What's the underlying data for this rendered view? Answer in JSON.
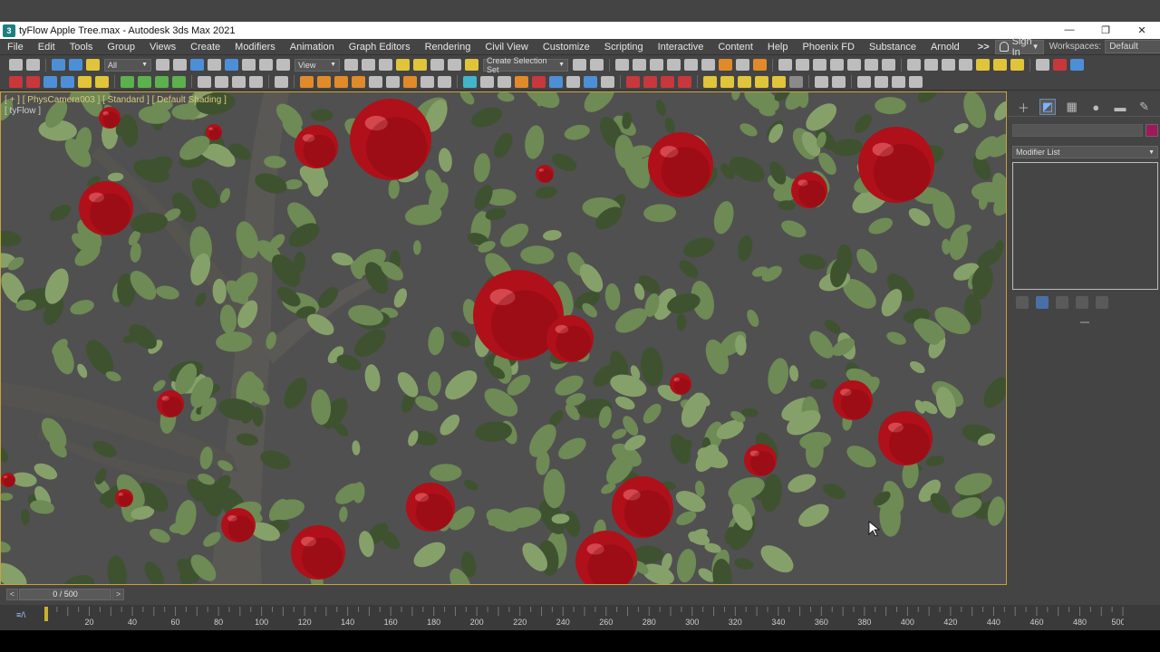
{
  "window": {
    "title": "tyFlow Apple Tree.max - Autodesk 3ds Max 2021",
    "app_icon_letter": "3",
    "minimize_glyph": "—",
    "restore_glyph": "❐",
    "close_glyph": "✕"
  },
  "menubar": {
    "items": [
      "File",
      "Edit",
      "Tools",
      "Group",
      "Views",
      "Create",
      "Modifiers",
      "Animation",
      "Graph Editors",
      "Rendering",
      "Civil View",
      "Customize",
      "Scripting",
      "Interactive",
      "Content",
      "Help",
      "Phoenix FD",
      "Substance",
      "Arnold"
    ],
    "more": ">>",
    "sign_in": "Sign In",
    "workspaces_label": "Workspaces:",
    "workspace_value": "Default"
  },
  "toolbar": {
    "selection_filter": "All",
    "reference_coord": "View",
    "named_selection": "Create Selection Set"
  },
  "viewport": {
    "label": "[ + ] [ PhysCamera003 ] [ Standard ] [ Default Shading ]",
    "sublabel": "[ tyFlow ]",
    "colors": {
      "leaf": "#6e8a55",
      "leaf_dark": "#3e5230",
      "apple": "#b0101a",
      "trunk": "#5a5854",
      "background": "#505050"
    }
  },
  "command_panel": {
    "tabs": [
      "create-tab",
      "modify-tab",
      "hierarchy-tab",
      "motion-tab",
      "display-tab",
      "utilities-tab"
    ],
    "modifier_list": "Modifier List",
    "object_color": "#a0185a"
  },
  "timeslider": {
    "position": "0 / 500",
    "prev": "<",
    "next": ">"
  },
  "trackbar": {
    "icon_text": "≡/\\",
    "ticks": [
      20,
      40,
      60,
      80,
      100,
      120,
      140,
      160,
      180,
      200,
      220,
      240,
      260,
      280,
      300,
      320,
      340,
      360,
      380,
      400,
      420,
      440,
      460,
      480,
      500
    ],
    "max": 500
  }
}
